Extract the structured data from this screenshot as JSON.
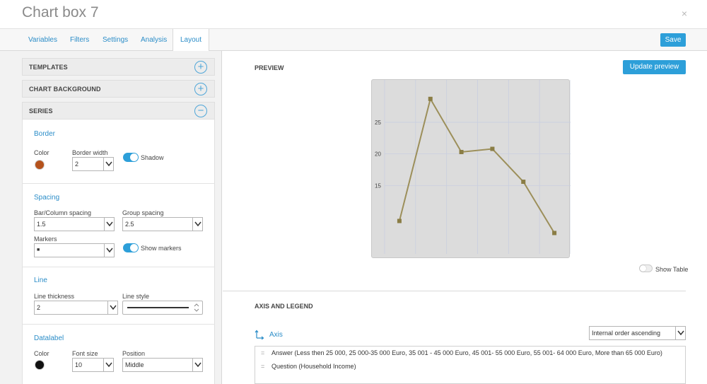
{
  "title": "Chart box 7",
  "tabs": [
    "Variables",
    "Filters",
    "Settings",
    "Analysis",
    "Layout"
  ],
  "active_tab": "Layout",
  "save_label": "Save",
  "close_glyph": "×",
  "sections": {
    "templates": "TEMPLATES",
    "chart_background": "CHART BACKGROUND",
    "series": "SERIES"
  },
  "border": {
    "title": "Border",
    "color_label": "Color",
    "color": "#b5521c",
    "width_label": "Border width",
    "width_value": "2",
    "shadow_label": "Shadow"
  },
  "spacing": {
    "title": "Spacing",
    "bar_label": "Bar/Column spacing",
    "bar_value": "1.5",
    "group_label": "Group spacing",
    "group_value": "2.5",
    "markers_label": "Markers",
    "markers_value": "■",
    "show_markers_label": "Show markers"
  },
  "line": {
    "title": "Line",
    "thickness_label": "Line thickness",
    "thickness_value": "2",
    "style_label": "Line style"
  },
  "datalabel": {
    "title": "Datalabel",
    "color_label": "Color",
    "color": "#111111",
    "font_size_label": "Font size",
    "font_size_value": "10",
    "position_label": "Position",
    "position_value": "Middle"
  },
  "preview": {
    "header": "PREVIEW",
    "update_label": "Update preview",
    "show_table_label": "Show Table"
  },
  "chart_data": {
    "type": "line",
    "x": [
      1,
      2,
      3,
      4,
      5,
      6
    ],
    "values": [
      9.4,
      28.7,
      20.3,
      20.8,
      15.6,
      7.5
    ],
    "yticks": [
      "25",
      "20",
      "15"
    ],
    "ylim": [
      4.2,
      31.7
    ],
    "grid": true,
    "line_color": "#9c8f5a",
    "marker_color": "#8a7d45",
    "background": "#dcdcdc"
  },
  "axis_legend": {
    "header": "AXIS AND LEGEND",
    "axis_label": "Axis",
    "order_value": "Internal order ascending",
    "items": [
      "Answer (Less then 25 000, 25 000-35 000 Euro, 35 001 - 45 000 Euro, 45 001- 55 000 Euro, 55 001- 64 000 Euro, More than 65 000 Euro)",
      "Question (Household Income)"
    ]
  }
}
